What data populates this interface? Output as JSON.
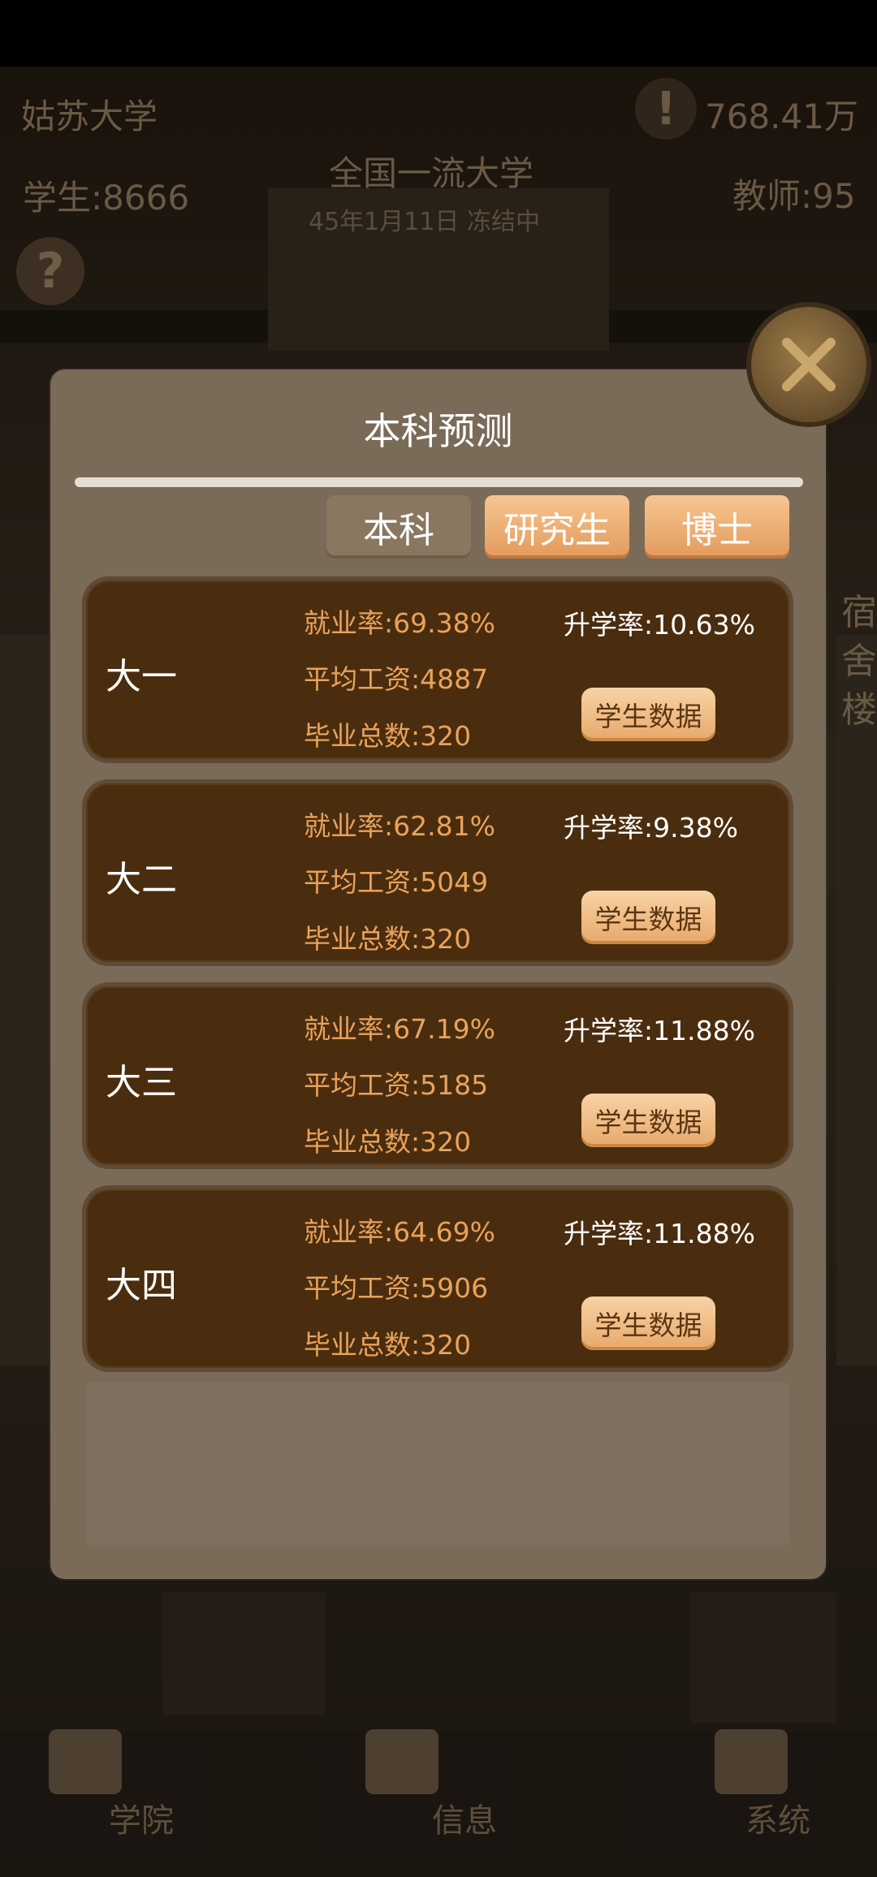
{
  "hud": {
    "school_name": "姑苏大学",
    "money": "768.41万",
    "rank_title": "全国一流大学",
    "date_status": "45年1月11日 冻结中",
    "students": "学生:8666",
    "teachers": "教师:95",
    "side_building": "宿舍楼"
  },
  "bottom_nav": [
    {
      "label": "学院"
    },
    {
      "label": "信息"
    },
    {
      "label": "系统"
    }
  ],
  "modal": {
    "title": "本科预测",
    "tabs": [
      {
        "label": "本科",
        "active": false
      },
      {
        "label": "研究生",
        "active": true
      },
      {
        "label": "博士",
        "active": true
      }
    ],
    "rows": [
      {
        "year": "大一",
        "employment": "就业率:69.38%",
        "salary": "平均工资:4887",
        "graduates": "毕业总数:320",
        "further_study": "升学率:10.63%",
        "button": "学生数据"
      },
      {
        "year": "大二",
        "employment": "就业率:62.81%",
        "salary": "平均工资:5049",
        "graduates": "毕业总数:320",
        "further_study": "升学率:9.38%",
        "button": "学生数据"
      },
      {
        "year": "大三",
        "employment": "就业率:67.19%",
        "salary": "平均工资:5185",
        "graduates": "毕业总数:320",
        "further_study": "升学率:11.88%",
        "button": "学生数据"
      },
      {
        "year": "大四",
        "employment": "就业率:64.69%",
        "salary": "平均工资:5906",
        "graduates": "毕业总数:320",
        "further_study": "升学率:11.88%",
        "button": "学生数据"
      }
    ]
  },
  "icons": {
    "help": "?",
    "alert": "!",
    "close": "close-x-icon"
  },
  "colors": {
    "modal_bg": "#7a6a58",
    "card_bg": "#4a2d0f",
    "stat_text": "#e9a25c",
    "tab_active": "#e39a5a"
  }
}
